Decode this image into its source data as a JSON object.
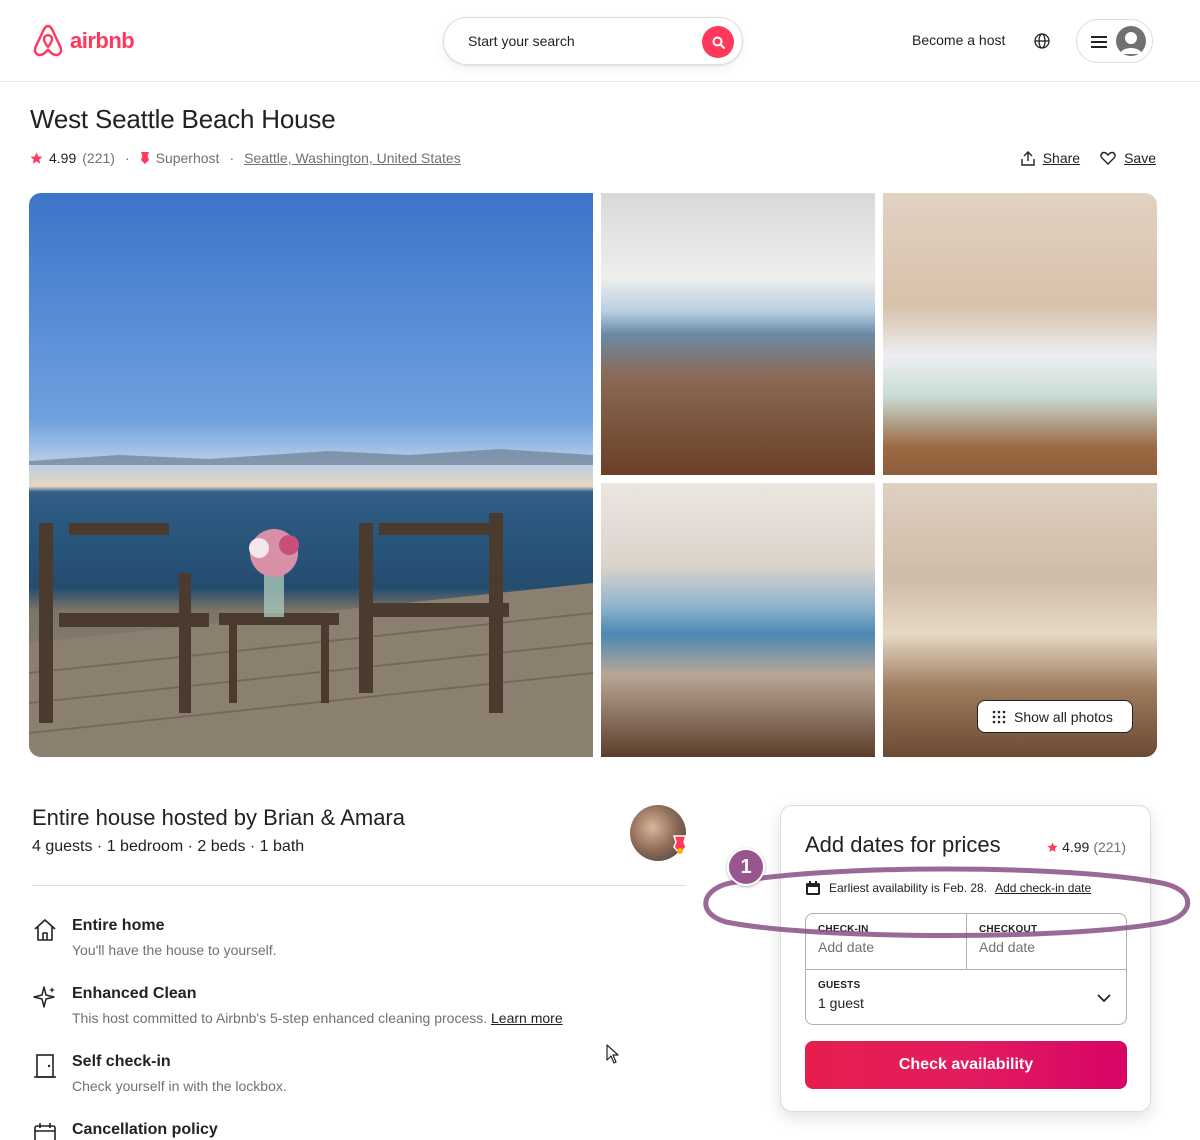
{
  "header": {
    "brand": "airbnb",
    "search_placeholder": "Start your search",
    "become_host": "Become a host",
    "brand_color": "#ff385c"
  },
  "listing": {
    "title": "West Seattle Beach House",
    "rating": "4.99",
    "reviews": "(221)",
    "superhost": "Superhost",
    "location": "Seattle, Washington, United States",
    "share": "Share",
    "save": "Save",
    "show_all_photos": "Show all photos"
  },
  "host": {
    "title": "Entire house hosted by Brian & Amara",
    "summary": "4 guests · 1 bedroom · 2 beds · 1 bath"
  },
  "features": [
    {
      "icon": "house-icon",
      "title": "Entire home",
      "desc": "You'll have the house to yourself."
    },
    {
      "icon": "sparkle-icon",
      "title": "Enhanced Clean",
      "desc": "This host committed to Airbnb's 5-step enhanced cleaning process.",
      "link": "Learn more"
    },
    {
      "icon": "door-icon",
      "title": "Self check-in",
      "desc": "Check yourself in with the lockbox."
    },
    {
      "icon": "calendar-icon",
      "title": "Cancellation policy"
    }
  ],
  "booking": {
    "title": "Add dates for prices",
    "rating": "4.99",
    "reviews": "(221)",
    "availability": "Earliest availability is Feb. 28.",
    "availability_link": "Add check-in date",
    "checkin_label": "CHECK-IN",
    "checkin_value": "Add date",
    "checkout_label": "CHECKOUT",
    "checkout_value": "Add date",
    "guests_label": "GUESTS",
    "guests_value": "1 guest",
    "button": "Check availability"
  },
  "annotation": {
    "number": "1",
    "color": "#98568f"
  }
}
